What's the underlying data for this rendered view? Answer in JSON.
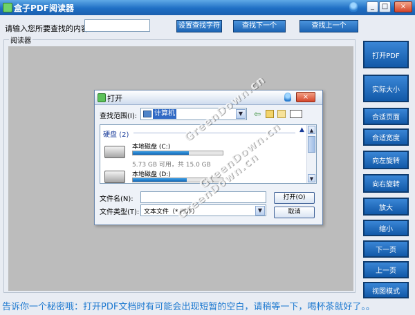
{
  "window": {
    "title": "盒子PDF阅读器",
    "controls": [
      "_",
      "□",
      "×"
    ]
  },
  "search": {
    "label": "请输入您所要查找的内容：",
    "input_value": "",
    "buttons": [
      "设置查找字符",
      "查找下一个",
      "查找上一个"
    ]
  },
  "reader": {
    "group_label": "阅读器"
  },
  "sidebar": {
    "buttons": [
      "打开PDF",
      "实际大小",
      "合适页面",
      "合适宽度",
      "向左旋转",
      "向右旋转",
      "放大",
      "缩小",
      "下一页",
      "上一页",
      "视图模式"
    ]
  },
  "dialog": {
    "title": "打开",
    "lookin_label": "查找范围(I):",
    "lookin_value": "计算机",
    "group_header": "硬盘 (2)",
    "drives": [
      {
        "name": "本地磁盘 (C:)",
        "info": "5.73 GB 可用，共 15.0 GB",
        "used_fraction": 0.62
      },
      {
        "name": "本地磁盘 (D:)",
        "info": "",
        "used_fraction": 0.6
      }
    ],
    "filename_label": "文件名(N):",
    "filename_value": "",
    "filetype_label": "文件类型(T):",
    "filetype_value": "文本文件（*.PDF）",
    "open_button": "打开(O)",
    "cancel_button": "取消"
  },
  "footer": {
    "message": "告诉你一个秘密哦：打开PDF文档时有可能会出现短暂的空白，请稍等一下，喝杯茶就好了。。"
  },
  "watermarks": [
    "GreenDown.cn",
    "GreenDown.cn",
    "GreenDown.cn"
  ]
}
